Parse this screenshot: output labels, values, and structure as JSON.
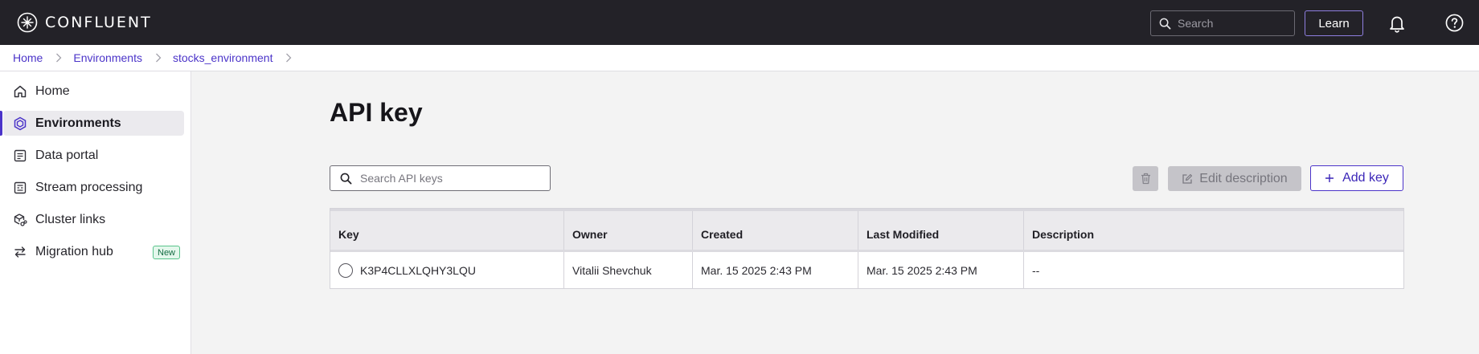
{
  "app": {
    "brand": "CONFLUENT",
    "search_placeholder": "Search",
    "learn_label": "Learn"
  },
  "breadcrumb": [
    "Home",
    "Environments",
    "stocks_environment"
  ],
  "sidebar": {
    "items": [
      {
        "label": "Home",
        "icon": "home-icon"
      },
      {
        "label": "Environments",
        "icon": "environments-icon",
        "active": true
      },
      {
        "label": "Data portal",
        "icon": "data-portal-icon"
      },
      {
        "label": "Stream processing",
        "icon": "stream-processing-icon"
      },
      {
        "label": "Cluster links",
        "icon": "cluster-links-icon"
      },
      {
        "label": "Migration hub",
        "icon": "migration-hub-icon",
        "badge": "New"
      }
    ]
  },
  "main": {
    "title": "API key",
    "search_placeholder": "Search API keys",
    "edit_label": "Edit description",
    "add_label": "Add key",
    "table": {
      "columns": [
        "Key",
        "Owner",
        "Created",
        "Last Modified",
        "Description"
      ],
      "rows": [
        {
          "key": "K3P4CLLXLQHY3LQU",
          "owner": "Vitalii Shevchuk",
          "created": "Mar. 15 2025 2:43 PM",
          "modified": "Mar. 15 2025 2:43 PM",
          "description": "--"
        }
      ]
    }
  },
  "colors": {
    "accent": "#4b34c9",
    "topbar": "#232228"
  }
}
